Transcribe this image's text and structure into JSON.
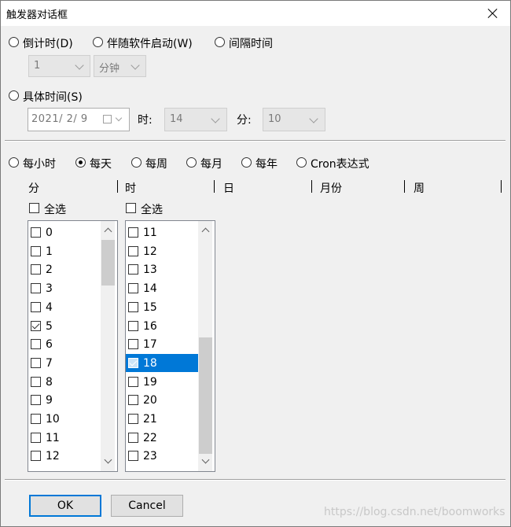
{
  "window": {
    "title": "触发器对话框"
  },
  "trigger_modes": {
    "countdown_label": "倒计时(D)",
    "with_software_label": "伴随软件启动(W)",
    "interval_label": "间隔时间",
    "interval_value": "1",
    "interval_unit": "分钟",
    "specific_time_label": "具体时间(S)",
    "date_value": "2021/  2/  9",
    "hour_label": "时:",
    "hour_value": "14",
    "minute_label": "分:",
    "minute_value": "10"
  },
  "frequency": {
    "options": [
      "每小时",
      "每天",
      "每周",
      "每月",
      "每年",
      "Cron表达式"
    ],
    "selected": "每天"
  },
  "columns": {
    "minute": "分",
    "hour": "时",
    "day": "日",
    "month": "月份",
    "week": "周"
  },
  "minute_list": {
    "select_all_label": "全选",
    "items": [
      {
        "label": "0",
        "checked": false
      },
      {
        "label": "1",
        "checked": false
      },
      {
        "label": "2",
        "checked": false
      },
      {
        "label": "3",
        "checked": false
      },
      {
        "label": "4",
        "checked": false
      },
      {
        "label": "5",
        "checked": true
      },
      {
        "label": "6",
        "checked": false
      },
      {
        "label": "7",
        "checked": false
      },
      {
        "label": "8",
        "checked": false
      },
      {
        "label": "9",
        "checked": false
      },
      {
        "label": "10",
        "checked": false
      },
      {
        "label": "11",
        "checked": false
      },
      {
        "label": "12",
        "checked": false
      }
    ]
  },
  "hour_list": {
    "select_all_label": "全选",
    "items": [
      {
        "label": "11",
        "checked": false
      },
      {
        "label": "12",
        "checked": false
      },
      {
        "label": "13",
        "checked": false
      },
      {
        "label": "14",
        "checked": false
      },
      {
        "label": "15",
        "checked": false
      },
      {
        "label": "16",
        "checked": false
      },
      {
        "label": "17",
        "checked": false
      },
      {
        "label": "18",
        "checked": true,
        "selected": true
      },
      {
        "label": "19",
        "checked": false
      },
      {
        "label": "20",
        "checked": false
      },
      {
        "label": "21",
        "checked": false
      },
      {
        "label": "22",
        "checked": false
      },
      {
        "label": "23",
        "checked": false
      }
    ]
  },
  "buttons": {
    "ok": "OK",
    "cancel": "Cancel"
  },
  "watermark": "https://blog.csdn.net/boomworks"
}
